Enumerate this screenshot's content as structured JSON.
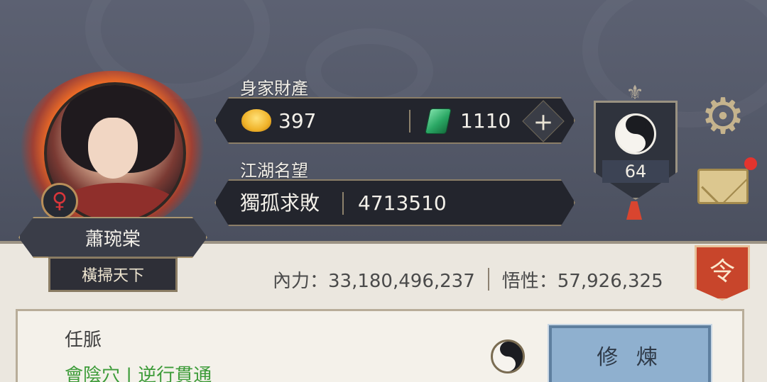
{
  "player": {
    "name": "蕭琬棠",
    "title": "橫掃天下",
    "gender_symbol": "♀"
  },
  "wealth": {
    "label": "身家財產",
    "gold": "397",
    "jade": "1110",
    "add_symbol": "+"
  },
  "fame": {
    "label": "江湖名望",
    "rank_title": "獨孤求敗",
    "value": "4713510"
  },
  "level_badge": {
    "level": "64"
  },
  "stats": {
    "inner_power": "內力：33,180,496,237",
    "insight": "悟性：57,926,325"
  },
  "order_badge": {
    "label": "令"
  },
  "meridian": {
    "name": "任脈",
    "point": "會陰穴 | 逆行貫通",
    "button_label": "修 煉"
  },
  "icons": {
    "settings": "gear-icon",
    "mail": "mail-icon",
    "gold": "gold-ingot-icon",
    "jade": "jade-icon"
  },
  "colors": {
    "top_background": "#555a6a",
    "bottom_background": "#ebe7df",
    "meridian_point": "#3c9b38",
    "button": "#8fb0cf",
    "notification": "#e3342e"
  }
}
